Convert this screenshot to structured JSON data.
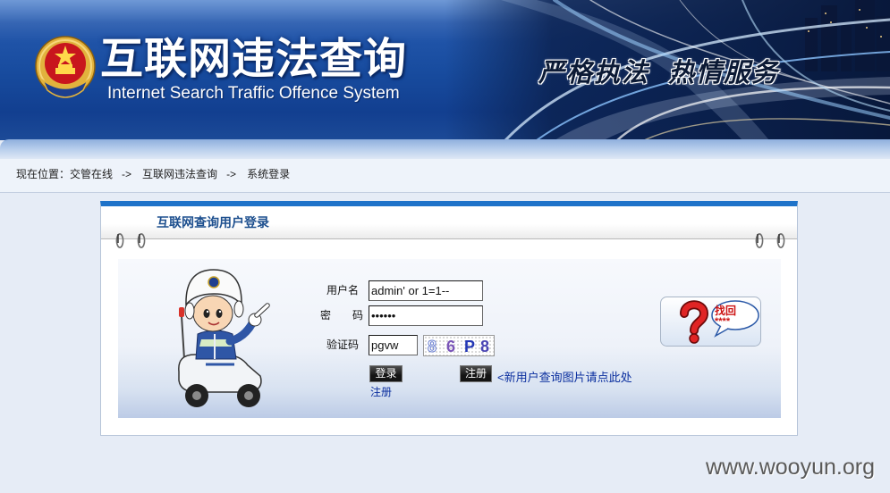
{
  "header": {
    "title": "互联网违法查询",
    "subtitle": "Internet Search Traffic Offence System",
    "slogan": "严格执法 热情服务"
  },
  "breadcrumb": {
    "label": "现在位置：",
    "items": [
      "交管在线",
      "互联网违法查询",
      "系统登录"
    ],
    "separator": "->"
  },
  "panel": {
    "title": "互联网查询用户登录"
  },
  "login_form": {
    "username_label": "用户名",
    "username_value": "admin' or 1=1--",
    "password_label": "密　　码",
    "password_value": "••••••",
    "captcha_label": "验证码",
    "captcha_value": "pgvw",
    "captcha_image_text": [
      "8",
      "6",
      "P",
      "8"
    ],
    "login_button": "登录",
    "register_button": "注册",
    "new_user_link": "<新用户查询图片请点此处",
    "register_link": "注册"
  },
  "find_password": {
    "label": "找回",
    "mask": "****"
  },
  "watermark": "www.wooyun.org",
  "icons": {
    "emblem": "police-emblem-icon",
    "mascot": "traffic-police-mascot",
    "find_password": "question-mark-icon"
  },
  "colors": {
    "page_bg": "#e6ecf6",
    "panel_accent": "#1f73c9",
    "panel_title": "#1d4f8e",
    "link": "#0b2f9f",
    "button_bg": "#141414"
  }
}
